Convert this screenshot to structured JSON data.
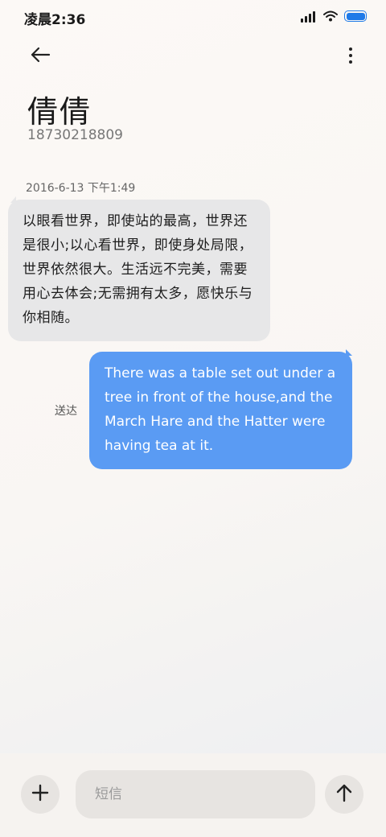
{
  "status_bar": {
    "time": "凌晨2:36",
    "battery_color": "#1f7ae8"
  },
  "header": {
    "back_icon": "arrow-left-icon",
    "more_icon": "more-vertical-icon",
    "contact_name": "倩倩",
    "contact_number": "18730218809"
  },
  "conversation": {
    "timestamp": "2016-6-13 下午1:49",
    "incoming_message": "以眼看世界，即使站的最高，世界还是很小;以心看世界，即使身处局限，世界依然很大。生活远不完美，需要用心去体会;无需拥有太多，愿快乐与你相随。",
    "outgoing_message": "There was a table set out under a tree in front of the house,and the March Hare and the Hatter were having tea at it.",
    "outgoing_status": "送达",
    "incoming_bubble_color": "#e7e7e8",
    "outgoing_bubble_color": "#5a9bf3"
  },
  "composer": {
    "add_icon": "plus-icon",
    "placeholder": "短信",
    "value": "",
    "send_icon": "arrow-up-icon"
  }
}
